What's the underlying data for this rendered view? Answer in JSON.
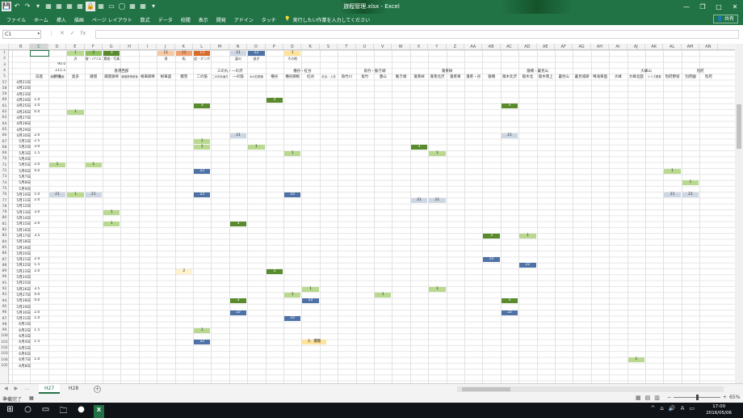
{
  "window": {
    "title": "旅程管理.xlsx - Excel",
    "controls": [
      "—",
      "❐",
      "□",
      "✕"
    ]
  },
  "quick_access": [
    "💾",
    "↶",
    "↷",
    "▾",
    "▦",
    "▦",
    "▦",
    "▦",
    "🔒",
    "▦",
    "▭",
    "◯",
    "▦",
    "▦",
    "▾"
  ],
  "ribbon": {
    "tabs": [
      "ファイル",
      "ホーム",
      "挿入",
      "描画",
      "ページ レイアウト",
      "数式",
      "データ",
      "校閲",
      "表示",
      "開発",
      "アドイン",
      "タッチ"
    ],
    "tell_me": "実行したい作業を入力してください",
    "share": "共有"
  },
  "formula_bar": {
    "name_box": "C1",
    "icons": [
      "⋮",
      "✕",
      "✓",
      "fx"
    ],
    "value": ""
  },
  "columns": [
    "B",
    "C",
    "D",
    "E",
    "F",
    "G",
    "H",
    "I",
    "J",
    "K",
    "L",
    "M",
    "N",
    "O",
    "P",
    "Q",
    "R",
    "S",
    "T",
    "U",
    "V",
    "W",
    "X",
    "Y",
    "Z",
    "AA",
    "AB",
    "AC",
    "AD",
    "AE",
    "AF",
    "AG",
    "AH",
    "AI",
    "AJ",
    "AK",
    "AL",
    "AM",
    "AN"
  ],
  "rows": [
    "1",
    "2",
    "3",
    "4",
    "5",
    "57",
    "58",
    "59",
    "60",
    "61",
    "62",
    "63",
    "64",
    "65",
    "66",
    "67",
    "68",
    "69",
    "70",
    "71",
    "72",
    "73",
    "74",
    "75",
    "76",
    "77",
    "78",
    "79",
    "80",
    "81",
    "82",
    "83",
    "84",
    "85",
    "86",
    "87",
    "88",
    "89",
    "90",
    "91",
    "92",
    "93",
    "94",
    "95",
    "96",
    "97",
    "98",
    "99",
    "100",
    "101",
    "102",
    "103",
    "104",
    "105"
  ],
  "legend_row1": [
    {
      "label": "1",
      "color": "#b8d98f",
      "col": "E"
    },
    {
      "label": "2",
      "color": "#8fbf5a",
      "col": "F"
    },
    {
      "label": "3",
      "color": "#5a8a2e",
      "col": "G"
    },
    {
      "label": "11",
      "color": "#f6c9a5",
      "col": "J"
    },
    {
      "label": "12",
      "color": "#f0a070",
      "col": "K"
    },
    {
      "label": "13",
      "color": "#d86a2a",
      "col": "L"
    },
    {
      "label": "21",
      "color": "#cdd6e3",
      "col": "N"
    },
    {
      "label": "22",
      "color": "#4f72a6",
      "col": "O"
    },
    {
      "label": "1",
      "color": "#ffe39a",
      "col": "Q"
    }
  ],
  "legend_row2": [
    {
      "label": "沢",
      "col": "E"
    },
    {
      "label": "縦・バリエーション",
      "col": "F"
    },
    {
      "label": "素描・写真",
      "col": "G"
    },
    {
      "label": "滝",
      "col": "J"
    },
    {
      "label": "転",
      "col": "K"
    },
    {
      "label": "追・オンボード",
      "col": "L"
    },
    {
      "label": "裏の",
      "col": "N"
    },
    {
      "label": "逃ぎ",
      "col": "O"
    },
    {
      "label": "その他",
      "col": "Q"
    }
  ],
  "summary": {
    "e3": "90.0",
    "e4": "215.5"
  },
  "group_headers": [
    {
      "label": "香港西部",
      "col": "G"
    },
    {
      "label": "三の丸・一の沢",
      "col": "M"
    },
    {
      "label": "櫓谷・紅谷",
      "col": "Q"
    },
    {
      "label": "角竹・動き頭",
      "col": "U"
    },
    {
      "label": "蓬莱峡",
      "col": "Y"
    },
    {
      "label": "猿橋・暑見山",
      "col": "AD"
    },
    {
      "label": "大峰山",
      "col": "AJ"
    },
    {
      "label": "別府",
      "col": "AM"
    }
  ],
  "col_headers_row5": [
    {
      "label": "時間",
      "col": "E"
    },
    {
      "label": "前進",
      "col": "C"
    },
    {
      "label": "蔵前・蔵面",
      "col": "D"
    },
    {
      "label": "奥多",
      "col": "E2"
    },
    {
      "label": "蔵壇",
      "col": "F"
    },
    {
      "label": "蔵壇鉄骨",
      "col": "G"
    },
    {
      "label": "蔵壇鉄骨前後",
      "col": "H"
    },
    {
      "label": "根筆鋼骨",
      "col": "I"
    },
    {
      "label": "根筆盛",
      "col": "J"
    },
    {
      "label": "積雪",
      "col": "K"
    },
    {
      "label": "二の筋",
      "col": "L"
    },
    {
      "label": "二の沢北面方",
      "col": "M"
    },
    {
      "label": "一の筋",
      "col": "N"
    },
    {
      "label": "大の石筋落",
      "col": "O"
    },
    {
      "label": "櫓谷",
      "col": "P"
    },
    {
      "label": "櫓谷鋼根",
      "col": "Q"
    },
    {
      "label": "紅谷",
      "col": "R"
    },
    {
      "label": "紅谷・上流",
      "col": "S"
    },
    {
      "label": "角竹川",
      "col": "T"
    },
    {
      "label": "角竹",
      "col": "U"
    },
    {
      "label": "豊山",
      "col": "V"
    },
    {
      "label": "動き頭",
      "col": "W"
    },
    {
      "label": "蓬莱峡",
      "col": "X"
    },
    {
      "label": "蓬莱北沢",
      "col": "Y"
    },
    {
      "label": "蓬莱東",
      "col": "Z"
    },
    {
      "label": "蓬莱・谷",
      "col": "AA"
    },
    {
      "label": "猿橋",
      "col": "AB"
    },
    {
      "label": "猿木北沢",
      "col": "AC"
    },
    {
      "label": "猿木北",
      "col": "AD"
    },
    {
      "label": "猿木南上",
      "col": "AE"
    },
    {
      "label": "暑見山",
      "col": "AF"
    },
    {
      "label": "暑見城跡",
      "col": "AG"
    },
    {
      "label": "鳴滝東面",
      "col": "AH"
    },
    {
      "label": "大峰",
      "col": "AI"
    },
    {
      "label": "大峰北面",
      "col": "AJ"
    },
    {
      "label": "シミズ尾根",
      "col": "AK"
    },
    {
      "label": "別府野坂",
      "col": "AL"
    },
    {
      "label": "別府園",
      "col": "AM"
    },
    {
      "label": "別府",
      "col": "AN"
    }
  ],
  "dates": [
    "4月21日",
    "4月22日",
    "4月23日",
    "4月24日",
    "4月25日",
    "4月26日",
    "4月27日",
    "4月28日",
    "4月29日",
    "4月30日",
    "5月1日",
    "5月2日",
    "5月3日",
    "5月4日",
    "5月5日",
    "5月6日",
    "5月7日",
    "5月8日",
    "5月9日",
    "5月10日",
    "5月11日",
    "5月12日",
    "5月13日",
    "5月14日",
    "5月15日",
    "5月16日",
    "5月17日",
    "5月18日",
    "5月19日",
    "5月20日",
    "5月21日",
    "5月22日",
    "5月23日",
    "5月24日",
    "5月25日",
    "5月26日",
    "5月27日",
    "5月28日",
    "5月29日",
    "5月30日",
    "5月31日",
    "6月1日",
    "6月2日",
    "6月3日",
    "6月4日",
    "6月5日",
    "6月6日",
    "6月7日",
    "6月8日"
  ],
  "hours": {
    "60": "1.0",
    "61": "2.0",
    "62": "0.0",
    "66": "2.0",
    "67": "2.5",
    "68": "3.0",
    "69": "1.5",
    "71": "2.0",
    "72": "4.0",
    "76": "5.0",
    "77": "2.0",
    "79": "3.0",
    "81": "2.0",
    "83": "3.5",
    "87": "2.0",
    "88": "1.5",
    "89": "2.0",
    "92": "3.5",
    "93": "4.0",
    "94": "4.0",
    "96": "2.0",
    "97": "1.0",
    "99": "1.5",
    "101": "1.5",
    "104": "1.0"
  },
  "blocks": [
    {
      "row": "60",
      "col": "P",
      "label": "3",
      "color": "#5a8a2e",
      "text": "#fff"
    },
    {
      "row": "61",
      "col": "L",
      "label": "3",
      "color": "#5a8a2e",
      "text": "#fff"
    },
    {
      "row": "61",
      "col": "AC",
      "label": "3",
      "color": "#5a8a2e",
      "text": "#fff"
    },
    {
      "row": "62",
      "col": "E",
      "label": "1",
      "color": "#b8d98f",
      "text": "#333"
    },
    {
      "row": "66",
      "col": "N",
      "label": "21",
      "color": "#cdd6e3",
      "text": "#333"
    },
    {
      "row": "66",
      "col": "AC",
      "label": "21",
      "color": "#cdd6e3",
      "text": "#333"
    },
    {
      "row": "67",
      "col": "L",
      "label": "1",
      "color": "#b8d98f",
      "text": "#333"
    },
    {
      "row": "68",
      "col": "L",
      "label": "1",
      "color": "#b8d98f",
      "text": "#333"
    },
    {
      "row": "68",
      "col": "O",
      "label": "1",
      "color": "#b8d98f",
      "text": "#333"
    },
    {
      "row": "68",
      "col": "X",
      "label": "3",
      "color": "#5a8a2e",
      "text": "#fff"
    },
    {
      "row": "69",
      "col": "Q",
      "label": "1",
      "color": "#b8d98f",
      "text": "#333"
    },
    {
      "row": "69",
      "col": "Y",
      "label": "1",
      "color": "#b8d98f",
      "text": "#333"
    },
    {
      "row": "71",
      "col": "D",
      "label": "1",
      "color": "#b8d98f",
      "text": "#333"
    },
    {
      "row": "71",
      "col": "F",
      "label": "1",
      "color": "#b8d98f",
      "text": "#333"
    },
    {
      "row": "72",
      "col": "L",
      "label": "22",
      "color": "#4f72a6",
      "text": "#fff"
    },
    {
      "row": "72",
      "col": "AL",
      "label": "1",
      "color": "#b8d98f",
      "text": "#333"
    },
    {
      "row": "74",
      "col": "AM",
      "label": "1",
      "color": "#b8d98f",
      "text": "#333"
    },
    {
      "row": "76",
      "col": "D",
      "label": "21",
      "color": "#cdd6e3",
      "text": "#333"
    },
    {
      "row": "76",
      "col": "E",
      "label": "1",
      "color": "#b8d98f",
      "text": "#333"
    },
    {
      "row": "76",
      "col": "F",
      "label": "21",
      "color": "#cdd6e3",
      "text": "#333"
    },
    {
      "row": "76",
      "col": "L",
      "label": "22",
      "color": "#4f72a6",
      "text": "#fff"
    },
    {
      "row": "76",
      "col": "Q",
      "label": "22",
      "color": "#4f72a6",
      "text": "#fff"
    },
    {
      "row": "76",
      "col": "AL",
      "label": "21",
      "color": "#cdd6e3",
      "text": "#333"
    },
    {
      "row": "76",
      "col": "AM",
      "label": "21",
      "color": "#cdd6e3",
      "text": "#333"
    },
    {
      "row": "77",
      "col": "X",
      "label": "21",
      "color": "#cdd6e3",
      "text": "#333"
    },
    {
      "row": "77",
      "col": "Y",
      "label": "21",
      "color": "#cdd6e3",
      "text": "#333"
    },
    {
      "row": "79",
      "col": "G",
      "label": "1",
      "color": "#b8d98f",
      "text": "#333"
    },
    {
      "row": "81",
      "col": "G",
      "label": "1",
      "color": "#b8d98f",
      "text": "#333"
    },
    {
      "row": "81",
      "col": "N",
      "label": "3",
      "color": "#5a8a2e",
      "text": "#fff"
    },
    {
      "row": "83",
      "col": "AB",
      "label": "3",
      "color": "#5a8a2e",
      "text": "#fff"
    },
    {
      "row": "83",
      "col": "AD",
      "label": "1",
      "color": "#b8d98f",
      "text": "#333"
    },
    {
      "row": "87",
      "col": "AB",
      "label": "22",
      "color": "#4f72a6",
      "text": "#fff"
    },
    {
      "row": "88",
      "col": "AD",
      "label": "22",
      "color": "#4f72a6",
      "text": "#fff"
    },
    {
      "row": "89",
      "col": "K",
      "label": "2",
      "color": "#fff2cc",
      "text": "#333"
    },
    {
      "row": "89",
      "col": "P",
      "label": "3",
      "color": "#5a8a2e",
      "text": "#fff"
    },
    {
      "row": "92",
      "col": "R",
      "label": "1",
      "color": "#b8d98f",
      "text": "#333"
    },
    {
      "row": "92",
      "col": "Y",
      "label": "1",
      "color": "#b8d98f",
      "text": "#333"
    },
    {
      "row": "93",
      "col": "Q",
      "label": "1",
      "color": "#b8d98f",
      "text": "#333"
    },
    {
      "row": "93",
      "col": "V",
      "label": "1",
      "color": "#b8d98f",
      "text": "#333"
    },
    {
      "row": "94",
      "col": "N",
      "label": "3",
      "color": "#5a8a2e",
      "text": "#fff"
    },
    {
      "row": "94",
      "col": "R",
      "label": "22",
      "color": "#4f72a6",
      "text": "#fff"
    },
    {
      "row": "94",
      "col": "AC",
      "label": "3",
      "color": "#5a8a2e",
      "text": "#fff"
    },
    {
      "row": "96",
      "col": "N",
      "label": "22",
      "color": "#4f72a6",
      "text": "#fff"
    },
    {
      "row": "96",
      "col": "AC",
      "label": "22",
      "color": "#4f72a6",
      "text": "#fff"
    },
    {
      "row": "97",
      "col": "Q",
      "label": "22",
      "color": "#4f72a6",
      "text": "#fff"
    },
    {
      "row": "99",
      "col": "L",
      "label": "1",
      "color": "#b8d98f",
      "text": "#333"
    },
    {
      "row": "101",
      "col": "L",
      "label": "22",
      "color": "#4f72a6",
      "text": "#fff"
    },
    {
      "row": "101",
      "col": "R",
      "label": "3：遭難",
      "color": "#ffe39a",
      "text": "#333"
    },
    {
      "row": "104",
      "col": "AJ",
      "label": "1",
      "color": "#b8d98f",
      "text": "#333"
    }
  ],
  "sheets": {
    "tabs": [
      "H27",
      "H28"
    ],
    "active": "H27",
    "nav": [
      "◀",
      "▶",
      "…"
    ],
    "add": "+"
  },
  "status": {
    "ready": "準備完了",
    "icon": "▦",
    "views": [
      "▦",
      "▤",
      "▥"
    ],
    "zoom": "65%",
    "zoom_minus": "−",
    "zoom_plus": "+"
  },
  "taskbar": {
    "icons": [
      "⊞",
      "○",
      "▭",
      "🗀",
      "●",
      "X"
    ],
    "tray": [
      "^",
      "⌂",
      "🔊",
      "A",
      "▭"
    ],
    "time": "17:00",
    "date": "2016/05/06"
  }
}
